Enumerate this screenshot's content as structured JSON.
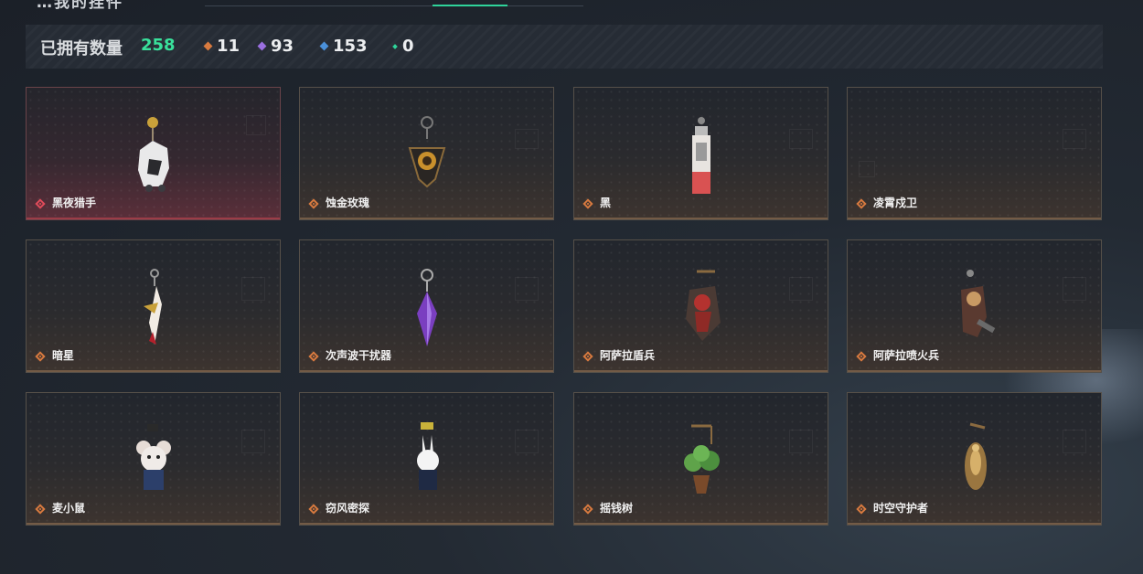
{
  "header": {
    "title_fragment": "…我的挂件",
    "active_tab_color": "#2fd39a"
  },
  "stats": {
    "owned_label": "已拥有数量",
    "owned_total": "258",
    "tiers": [
      {
        "name": "orange",
        "color": "#d87a3f",
        "count": "11"
      },
      {
        "name": "purple",
        "color": "#9a6fe0",
        "count": "93"
      },
      {
        "name": "blue",
        "color": "#4a90d9",
        "count": "153"
      },
      {
        "name": "green",
        "color": "#2fd39a",
        "count": "0"
      }
    ]
  },
  "items": [
    {
      "name": "黑夜猎手",
      "rarity": "red",
      "icon": "hunter-charm-icon"
    },
    {
      "name": "蚀金玫瑰",
      "rarity": "orange",
      "icon": "rose-charm-icon"
    },
    {
      "name": "黑",
      "rarity": "orange",
      "icon": "card-charm-icon"
    },
    {
      "name": "凌霄戍卫",
      "rarity": "orange",
      "icon": "empty-charm-icon"
    },
    {
      "name": "暗星",
      "rarity": "orange",
      "icon": "blade-charm-icon"
    },
    {
      "name": "次声波干扰器",
      "rarity": "orange",
      "icon": "crystal-charm-icon"
    },
    {
      "name": "阿萨拉盾兵",
      "rarity": "orange",
      "icon": "shield-soldier-charm-icon"
    },
    {
      "name": "阿萨拉喷火兵",
      "rarity": "orange",
      "icon": "flamethrower-charm-icon"
    },
    {
      "name": "麦小鼠",
      "rarity": "orange",
      "icon": "mouse-charm-icon"
    },
    {
      "name": "窃风密探",
      "rarity": "orange",
      "icon": "rabbit-charm-icon"
    },
    {
      "name": "摇钱树",
      "rarity": "orange",
      "icon": "money-tree-charm-icon"
    },
    {
      "name": "时空守护者",
      "rarity": "orange",
      "icon": "guardian-charm-icon"
    }
  ]
}
